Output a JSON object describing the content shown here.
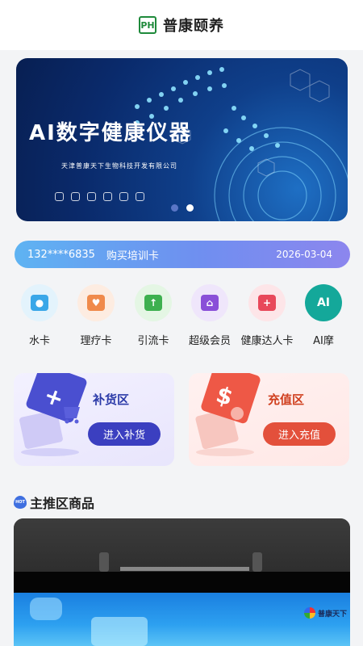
{
  "header": {
    "logo_text": "PH",
    "title": "普康颐养"
  },
  "banner": {
    "title": "AI数字健康仪器",
    "company": "天津普康天下生物科技开发有限公司",
    "pagination": {
      "count": 2,
      "active_index": 1
    }
  },
  "ticker": {
    "user": "132****6835",
    "action": "购买培训卡",
    "date": "2026-03-04"
  },
  "categories": [
    {
      "label": "水卡",
      "icon": "water-card-icon",
      "color": "#3aa7e8",
      "bg": "#e3f3fc"
    },
    {
      "label": "理疗卡",
      "icon": "therapy-card-icon",
      "color": "#f08a4b",
      "bg": "#fdece1"
    },
    {
      "label": "引流卡",
      "icon": "traffic-card-icon",
      "color": "#3db04f",
      "bg": "#e4f6e4"
    },
    {
      "label": "超级会员",
      "icon": "super-member-icon",
      "color": "#8a4fd8",
      "bg": "#efe6fb"
    },
    {
      "label": "健康达人卡",
      "icon": "health-expert-card-icon",
      "color": "#e8485a",
      "bg": "#fde5e8"
    },
    {
      "label": "AI摩",
      "icon": "ai-massage-icon",
      "icon_text": "AI",
      "color": "#14a89a",
      "bg": "#d9f3f0"
    }
  ],
  "cards": {
    "restock": {
      "title": "补货区",
      "button": "进入补货"
    },
    "recharge": {
      "title": "充值区",
      "button": "进入充值"
    }
  },
  "section": {
    "hot_badge": "HOT",
    "title": "主推区商品"
  },
  "product": {
    "brand": "普康天下"
  }
}
